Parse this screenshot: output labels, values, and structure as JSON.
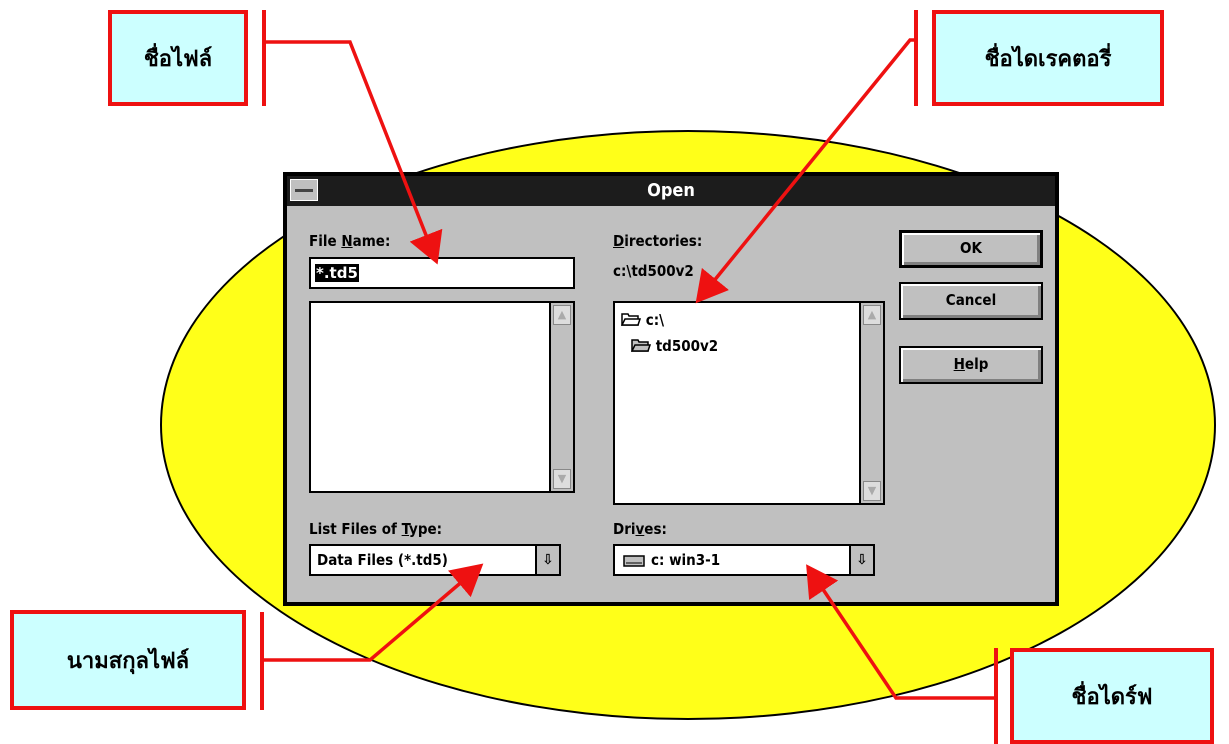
{
  "dialog": {
    "title": "Open",
    "file_name_label_pre": "File ",
    "file_name_label_u": "N",
    "file_name_label_post": "ame:",
    "file_name_value": "*.td5",
    "directories_label_u": "D",
    "directories_label_post": "irectories:",
    "current_directory": "c:\\td500v2",
    "directory_items": [
      {
        "icon": "open-folder-icon",
        "label": "c:\\"
      },
      {
        "icon": "open-folder-icon",
        "label": "td500v2"
      }
    ],
    "list_type_label_pre": "List Files of ",
    "list_type_label_u": "T",
    "list_type_label_post": "ype:",
    "list_type_value": "Data Files (*.td5)",
    "drives_label_pre": "Dri",
    "drives_label_u": "v",
    "drives_label_post": "es:",
    "drives_value": "c: win3-1",
    "buttons": {
      "ok": "OK",
      "cancel": "Cancel",
      "help_u": "H",
      "help_post": "elp"
    }
  },
  "callouts": {
    "file_name": "ชื่อไฟล์",
    "directory_name": "ชื่อไดเรคตอรี่",
    "file_extension": "นามสกุลไฟล์",
    "drive_name": "ชื่อไดร์ฟ"
  },
  "colors": {
    "ellipse": "#ffff19",
    "callout_fill": "#ccffff",
    "callout_border": "#ee1111",
    "dialog_face": "#c0c0c0",
    "titlebar": "#1c1c1c"
  }
}
